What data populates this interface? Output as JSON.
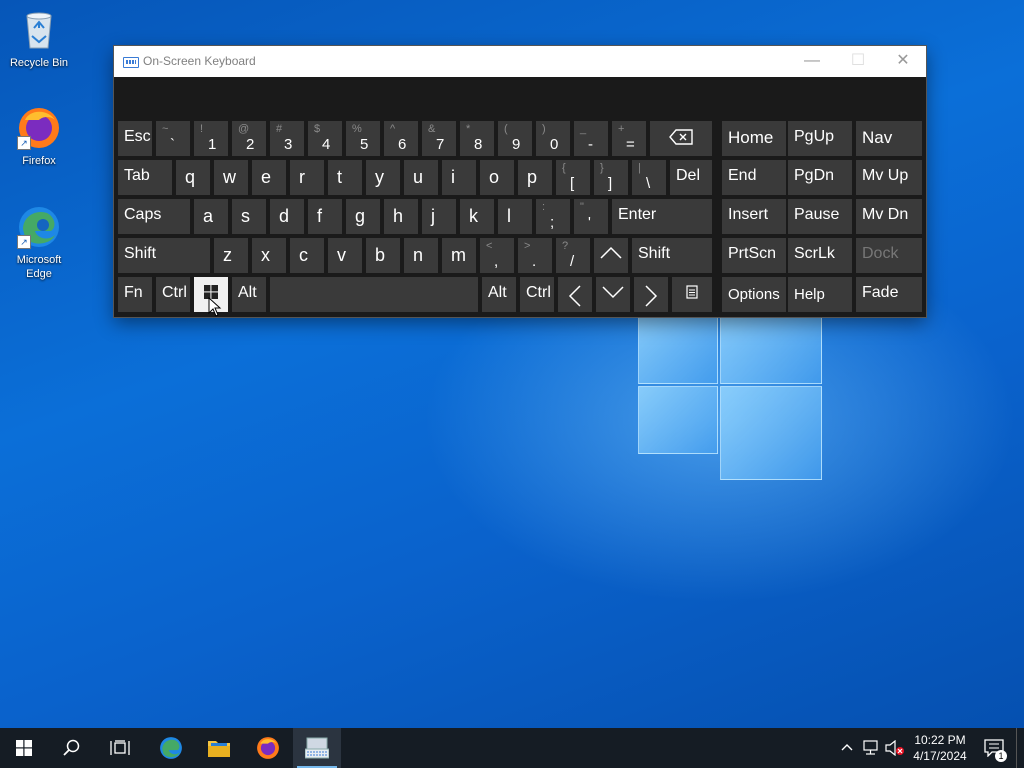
{
  "desktop": {
    "icons": [
      {
        "label": "Recycle Bin"
      },
      {
        "label": "Firefox"
      },
      {
        "label": "Microsoft Edge"
      }
    ]
  },
  "osk": {
    "title": "On-Screen Keyboard",
    "rows": {
      "row1": [
        {
          "main": "Esc"
        },
        {
          "top": "~",
          "bot": "`"
        },
        {
          "top": "!",
          "bot": "1"
        },
        {
          "top": "@",
          "bot": "2"
        },
        {
          "top": "#",
          "bot": "3"
        },
        {
          "top": "$",
          "bot": "4"
        },
        {
          "top": "%",
          "bot": "5"
        },
        {
          "top": "^",
          "bot": "6"
        },
        {
          "top": "&",
          "bot": "7"
        },
        {
          "top": "*",
          "bot": "8"
        },
        {
          "top": "(",
          "bot": "9"
        },
        {
          "top": ")",
          "bot": "0"
        },
        {
          "top": "_",
          "bot": "-"
        },
        {
          "top": "+",
          "bot": "="
        },
        {
          "icon": "backspace-icon"
        }
      ],
      "row2": [
        {
          "main": "Tab"
        },
        {
          "main": "q"
        },
        {
          "main": "w"
        },
        {
          "main": "e"
        },
        {
          "main": "r"
        },
        {
          "main": "t"
        },
        {
          "main": "y"
        },
        {
          "main": "u"
        },
        {
          "main": "i"
        },
        {
          "main": "o"
        },
        {
          "main": "p"
        },
        {
          "top": "{",
          "bot": "["
        },
        {
          "top": "}",
          "bot": "]"
        },
        {
          "top": "|",
          "bot": "\\"
        },
        {
          "main": "Del"
        }
      ],
      "row3": [
        {
          "main": "Caps"
        },
        {
          "main": "a"
        },
        {
          "main": "s"
        },
        {
          "main": "d"
        },
        {
          "main": "f"
        },
        {
          "main": "g"
        },
        {
          "main": "h"
        },
        {
          "main": "j"
        },
        {
          "main": "k"
        },
        {
          "main": "l"
        },
        {
          "top": ":",
          "bot": ";"
        },
        {
          "top": "\"",
          "bot": "'"
        },
        {
          "main": "Enter"
        }
      ],
      "row4": [
        {
          "main": "Shift"
        },
        {
          "main": "z"
        },
        {
          "main": "x"
        },
        {
          "main": "c"
        },
        {
          "main": "v"
        },
        {
          "main": "b"
        },
        {
          "main": "n"
        },
        {
          "main": "m"
        },
        {
          "top": "<",
          "bot": ","
        },
        {
          "top": ">",
          "bot": "."
        },
        {
          "top": "?",
          "bot": "/"
        },
        {
          "icon": "arrow-up-icon"
        },
        {
          "main": "Shift"
        }
      ],
      "row5": [
        {
          "main": "Fn"
        },
        {
          "main": "Ctrl"
        },
        {
          "icon": "windows-icon"
        },
        {
          "main": "Alt"
        },
        {
          "main": ""
        },
        {
          "main": "Alt"
        },
        {
          "main": "Ctrl"
        },
        {
          "icon": "arrow-left-icon"
        },
        {
          "icon": "arrow-down-icon"
        },
        {
          "icon": "arrow-right-icon"
        },
        {
          "icon": "menu-icon"
        }
      ]
    },
    "nav": [
      [
        "Home",
        "PgUp",
        "Nav"
      ],
      [
        "End",
        "PgDn",
        "Mv Up"
      ],
      [
        "Insert",
        "Pause",
        "Mv Dn"
      ],
      [
        "PrtScn",
        "ScrLk",
        "Dock"
      ],
      [
        "Options",
        "Help",
        "Fade"
      ]
    ]
  },
  "taskbar": {
    "clock": {
      "time": "10:22 PM",
      "date": "4/17/2024"
    },
    "notification_count": "1"
  }
}
